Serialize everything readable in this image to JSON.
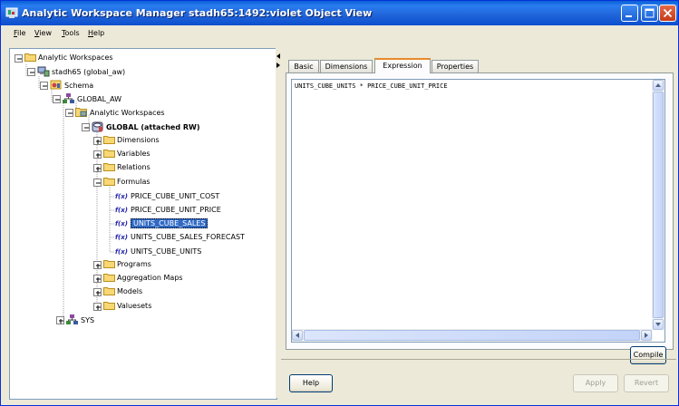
{
  "window": {
    "title": "Analytic Workspace Manager   stadh65:1492:violet   Object View"
  },
  "menu": [
    {
      "mnemonic": "F",
      "rest": "ile"
    },
    {
      "mnemonic": "V",
      "rest": "iew"
    },
    {
      "mnemonic": "T",
      "rest": "ools"
    },
    {
      "mnemonic": "H",
      "rest": "elp"
    }
  ],
  "tree": {
    "root": "Analytic Workspaces",
    "connection": "stadh65 (global_aw)",
    "schema": "Schema",
    "global_aw": "GLOBAL_AW",
    "aws_folder": "Analytic Workspaces",
    "global": "GLOBAL (attached RW)",
    "dimensions": "Dimensions",
    "variables": "Variables",
    "relations": "Relations",
    "formulas": "Formulas",
    "formula_items": [
      "PRICE_CUBE_UNIT_COST",
      "PRICE_CUBE_UNIT_PRICE",
      "UNITS_CUBE_SALES",
      "UNITS_CUBE_SALES_FORECAST",
      "UNITS_CUBE_UNITS"
    ],
    "fx_label": "f(x)",
    "programs": "Programs",
    "aggregation_maps": "Aggregation Maps",
    "models": "Models",
    "valuesets": "Valuesets",
    "sys": "SYS"
  },
  "tabs": [
    "Basic",
    "Dimensions",
    "Expression",
    "Properties"
  ],
  "active_tab": "Expression",
  "expression": "UNITS_CUBE_UNITS * PRICE_CUBE_UNIT_PRICE",
  "buttons": {
    "compile": "Compile",
    "help": "Help",
    "apply": "Apply",
    "revert": "Revert"
  }
}
